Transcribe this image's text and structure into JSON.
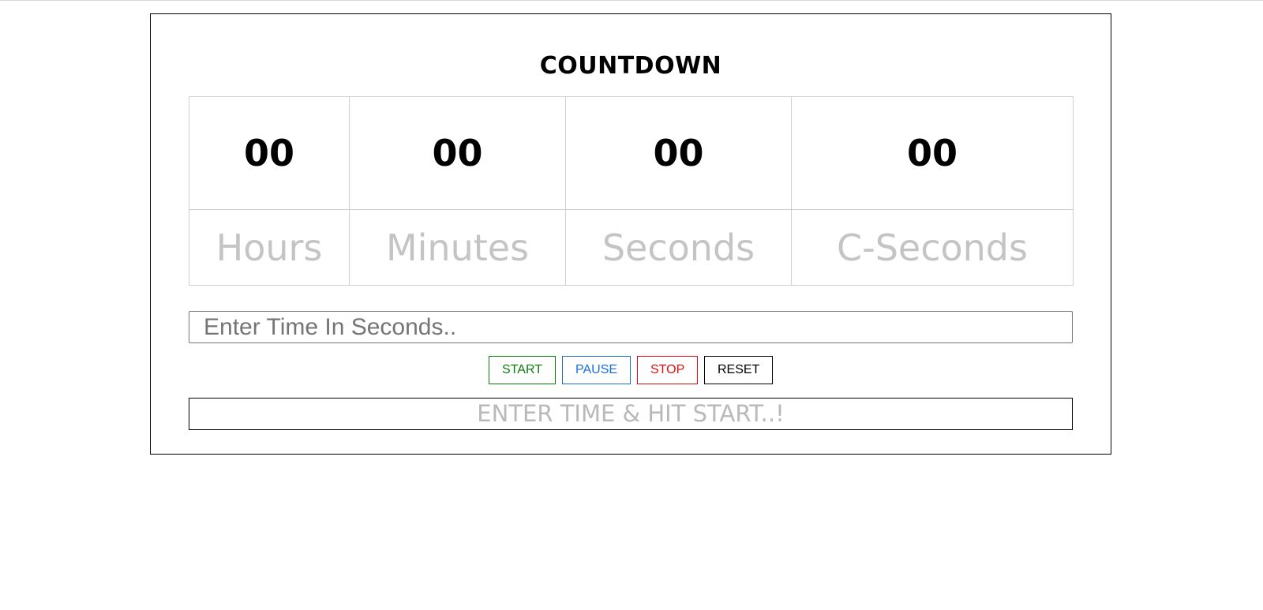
{
  "app": {
    "title": "COUNTDOWN"
  },
  "timer": {
    "values": [
      "00",
      "00",
      "00",
      "00"
    ],
    "labels": [
      "Hours",
      "Minutes",
      "Seconds",
      "C-Seconds"
    ]
  },
  "input": {
    "value": "",
    "placeholder": "Enter Time In Seconds.."
  },
  "controls": {
    "start_label": "START",
    "pause_label": "PAUSE",
    "stop_label": "STOP",
    "reset_label": "RESET"
  },
  "status": {
    "message": "ENTER TIME & HIT START..!"
  },
  "colors": {
    "start": "#0a7d0a",
    "pause": "#1a6ddb",
    "stop": "#e01010",
    "reset": "#000000",
    "label_gray": "#c4c4c4"
  }
}
